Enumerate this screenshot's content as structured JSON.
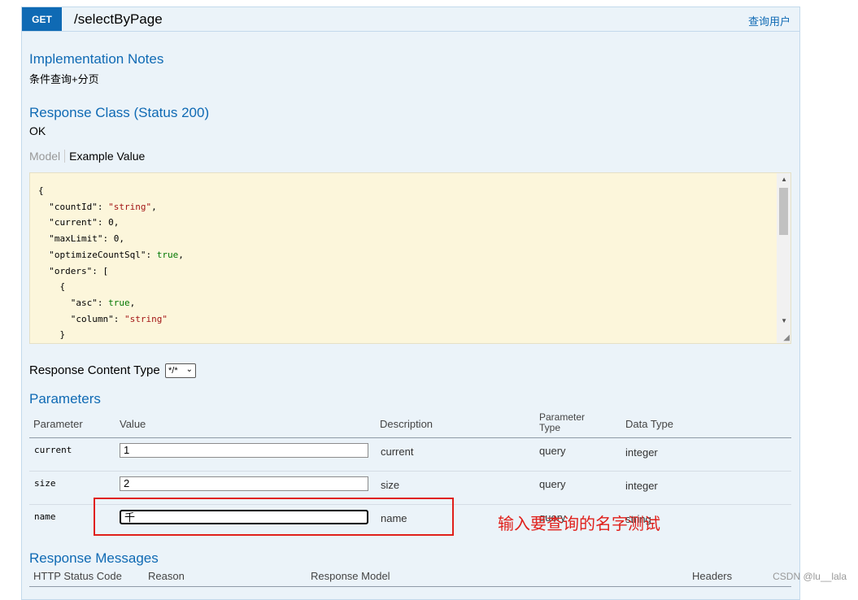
{
  "operation": {
    "method": "GET",
    "path": "/selectByPage",
    "summary": "查询用户"
  },
  "implementation": {
    "heading": "Implementation Notes",
    "text": "条件查询+分页"
  },
  "response_class": {
    "heading": "Response Class (Status 200)",
    "text": "OK",
    "tab_model": "Model",
    "tab_example": "Example Value",
    "example_lines": [
      "{",
      "  \"countId\": \"string\",",
      "  \"current\": 0,",
      "  \"maxLimit\": 0,",
      "  \"optimizeCountSql\": true,",
      "  \"orders\": [",
      "    {",
      "      \"asc\": true,",
      "      \"column\": \"string\"",
      "    }"
    ]
  },
  "content_type": {
    "label": "Response Content Type",
    "value": "*/*"
  },
  "parameters": {
    "heading": "Parameters",
    "columns": [
      "Parameter",
      "Value",
      "Description",
      "Parameter Type",
      "Data Type"
    ],
    "column_type_line1": "Parameter",
    "column_type_line2": "Type",
    "rows": [
      {
        "name": "current",
        "value": "1",
        "description": "current",
        "type": "query",
        "data_type": "integer"
      },
      {
        "name": "size",
        "value": "2",
        "description": "size",
        "type": "query",
        "data_type": "integer"
      },
      {
        "name": "name",
        "value": "千",
        "description": "name",
        "type": "query",
        "data_type": "string"
      }
    ]
  },
  "annotation": "输入要查询的名字测试",
  "response_messages": {
    "heading": "Response Messages",
    "columns": [
      "HTTP Status Code",
      "Reason",
      "Response Model",
      "Headers"
    ]
  },
  "watermark": "CSDN @lu__lala",
  "colors": {
    "accent": "#0f6ab4",
    "panel_bg": "#ebf3f9",
    "code_bg": "#fcf6db",
    "annotation": "#e0201b"
  }
}
